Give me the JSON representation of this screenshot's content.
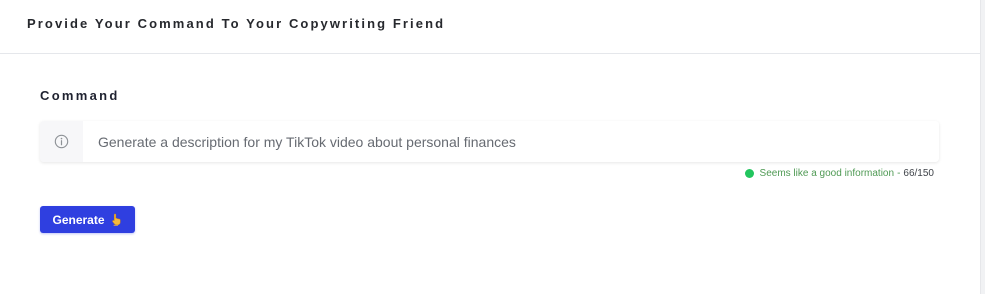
{
  "header": {
    "title": "Provide Your Command To Your Copywriting Friend"
  },
  "command": {
    "label": "Command",
    "value": "Generate a description for my TikTok video about personal finances",
    "addon_icon": "info-circle-icon"
  },
  "status": {
    "message": "Seems like a good information",
    "separator": "-",
    "count": "66/150",
    "color": "#22c55e"
  },
  "actions": {
    "generate_label": "Generate",
    "generate_icon": "pointing-hand-icon",
    "accent": "#2f3fe0"
  }
}
